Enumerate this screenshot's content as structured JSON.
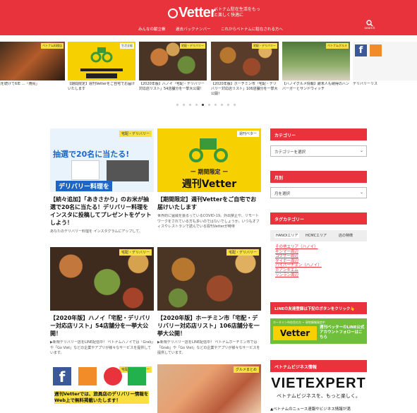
{
  "header": {
    "logo": "Vetter",
    "tagline": "ベトナム駐在生活をもっと楽しく快適に",
    "nav": [
      "みんなの献立帳",
      "過去バックナンバー",
      "これからベトナムに駐在される方へ"
    ],
    "search_label": "search",
    "brand_color": "#e8323c"
  },
  "slider": {
    "prev_icon": "‹",
    "next_icon": "›",
    "slides": [
      {
        "badge": "ベトナム料理店",
        "caption": "店を続けて6年 ...「焼鳥」"
      },
      {
        "badge": "生活全般",
        "caption": "【期間限定】週刊Vetterをご自宅でお届けいたします"
      },
      {
        "badge": "宅配・デリバリー",
        "caption": "【2020年版】ハノイ「宅配・デリバリー対応店リスト」54店舗分を一挙大公開！"
      },
      {
        "badge": "宅配・デリバリー",
        "caption": "【2020年版】ホーチミン市「宅配・デリバリー対応店リスト」106店舗分を一挙大公開！"
      },
      {
        "badge": "ベトナムグルメ",
        "caption": "【ハノイグルメ情報】跡未人も納得のハンバーガーとサンドウィッチ"
      },
      {
        "badge": "",
        "caption": "デリバリーリス"
      }
    ],
    "dots": 10,
    "active_dot": 4
  },
  "posts": [
    {
      "badge": "宅配・デリバリー",
      "title": "【続々追加】「あきさかり」のお米が抽選で20名に当たる！デリバリー料理をインスタに投稿してプレゼントをゲットしよう！",
      "excerpt": "あなたのデリバリー料理を インスタグラムにアップして、",
      "img_text": "抽選で20名に当たる!",
      "img_sub": "デリバリー料理を"
    },
    {
      "badge": "週刊ベター",
      "title": "【期間限定】週刊Vetterをご自宅でお届けいたします",
      "excerpt": "世界的に猛威を振るっているCOVID-19。外出禁止や、リモートワークをされている方も多いのではないでしょうか。いつもオフィスやレストランで読んでいる週刊Vetterが時待",
      "img_text": "ー 期間限定 ー",
      "img_sub": "週刊Vetter"
    },
    {
      "badge": "宅配・デリバリー",
      "title": "【2020年版】ハノイ「宅配・デリバリー対応店リスト」54店舗分を一挙大公開！",
      "excerpt": "▶新規デリバリー店をLINE配信中！ ベトナムハノイでは「Grab」や「Go Viet」などの企業やアプリが様々なサービスを提供しています。"
    },
    {
      "badge": "宅配・デリバリー",
      "title": "【2020年版】ホーチミン市「宅配・デリバリー対応店リスト」106店舗分を一挙大公開！",
      "excerpt": "▶新規デリバリー店をLINE配信中！ ベトナムホーチミン市では「Grab」や「Go Viet」などの企業やアプリが様々なサービスを提供しています。"
    },
    {
      "badge": "宅配・デリバリー",
      "title": "",
      "excerpt": "",
      "img_text": "週刊Vetterでは、旅員店のデリバリー情報をWeb上で無料掲載いたします！"
    },
    {
      "badge": "グルメまとめ",
      "title": "",
      "excerpt": ""
    }
  ],
  "sidebar": {
    "category_head": "カテゴリー",
    "category_select": "カテゴリーを選択",
    "month_head": "月別",
    "month_select": "月を選択",
    "tag_head": "タグカテゴリー",
    "tabs": [
      "HANOIエリア",
      "HCMCエリア",
      "店の特徴"
    ],
    "tags": [
      "その他エリア（ハノイ）",
      "キンマー周辺",
      "コウザー周辺",
      "タイホー周辺",
      "ハイバーチュン（ハノイ）",
      "ホアンキエム",
      "リンラン周辺"
    ],
    "line_head": "LINEの友達登録は下記のボタンをクリック👆",
    "line_box_title": "Vetter",
    "line_box_text": "週刊ベッターのLINE公式アカウントフォローはこちら",
    "line_box_top": "ホーチミン市在住の方 ~ 現地情報発信中",
    "biz_head": "ベトナムビジネス情報",
    "biz_logo": "VIETEXPERT",
    "biz_tagline": "ベトナムビジネスを、もっと楽しく。",
    "biz_note": "▲ベトナムのニュース速報やビジネス情報が満"
  }
}
